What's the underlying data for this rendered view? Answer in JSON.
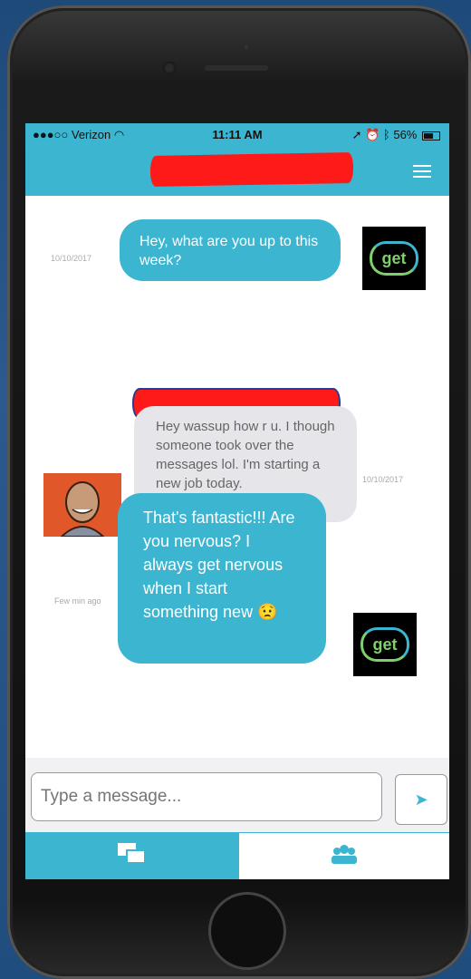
{
  "status": {
    "carrier": "●●●○○ Verizon",
    "time": "11:11 AM",
    "battery": "56%"
  },
  "messages": [
    {
      "text": "Hey, what are you up to this week?",
      "timestamp": "10/10/2017"
    },
    {
      "text": "Hey wassup how r u. I though someone took over the messages lol. I'm starting a new job today.",
      "timestamp": "10/10/2017"
    },
    {
      "text": "That's fantastic!!! Are you nervous? I always get nervous when I start something new",
      "timestamp": "Few min ago"
    }
  ],
  "logo": {
    "text": "get"
  },
  "composer": {
    "placeholder": "Type a message..."
  },
  "icons": {
    "menu": "menu-icon",
    "send": "send-icon",
    "chat_tab": "chat-bubbles-icon",
    "group_tab": "group-icon"
  },
  "colors": {
    "accent": "#3bb5d0",
    "redaction": "#ff1a1a"
  }
}
